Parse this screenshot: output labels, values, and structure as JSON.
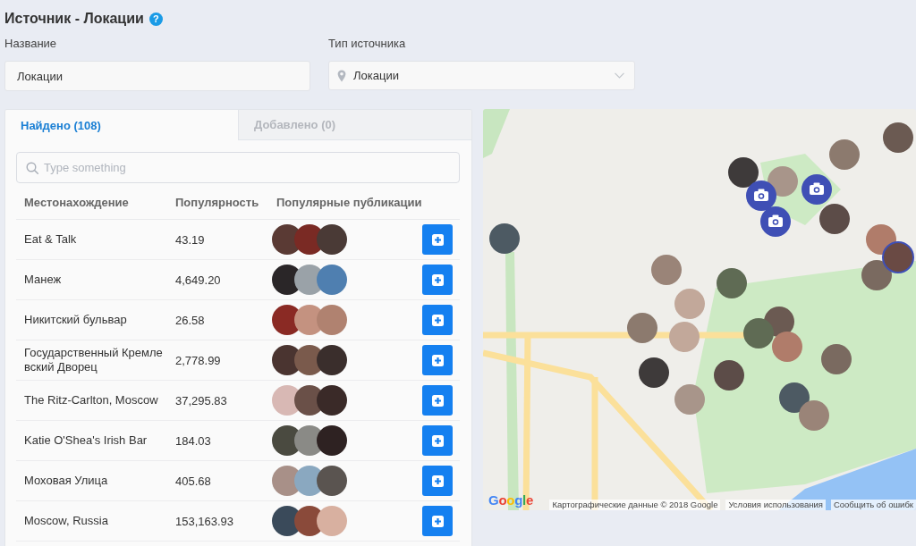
{
  "header": {
    "title": "Источник - Локации",
    "help": "?"
  },
  "form": {
    "fields": [
      {
        "kind": "text",
        "label": "Название",
        "value": "Локации"
      },
      {
        "kind": "select",
        "label": "Тип источника",
        "value": "Локации"
      }
    ]
  },
  "tabs": [
    {
      "label": "Найдено (108)",
      "selected": true
    },
    {
      "label": "Добавлено (0)",
      "selected": false
    }
  ],
  "search": {
    "placeholder": "Type something"
  },
  "table": {
    "columns": [
      "Местонахождение",
      "Популярность",
      "Популярные публикации"
    ],
    "rows": [
      {
        "location": "Eat & Talk",
        "popularity": "43.19"
      },
      {
        "location": "Манеж",
        "popularity": "4,649.20"
      },
      {
        "location": "Никитский бульвар",
        "popularity": "26.58"
      },
      {
        "location": "Государственный Кремлевский Дворец",
        "popularity": "2,778.99"
      },
      {
        "location": "The Ritz-Carlton, Moscow",
        "popularity": "37,295.83"
      },
      {
        "location": "Katie O'Shea's Irish Bar",
        "popularity": "184.03"
      },
      {
        "location": "Моховая Улица",
        "popularity": "405.68"
      },
      {
        "location": "Moscow, Russia",
        "popularity": "153,163.93"
      }
    ]
  },
  "map": {
    "logo": "Google",
    "data_credit": "Картографические данные © 2018 Google",
    "terms": "Условия использования",
    "report_error": "Сообщить об ошибк"
  }
}
